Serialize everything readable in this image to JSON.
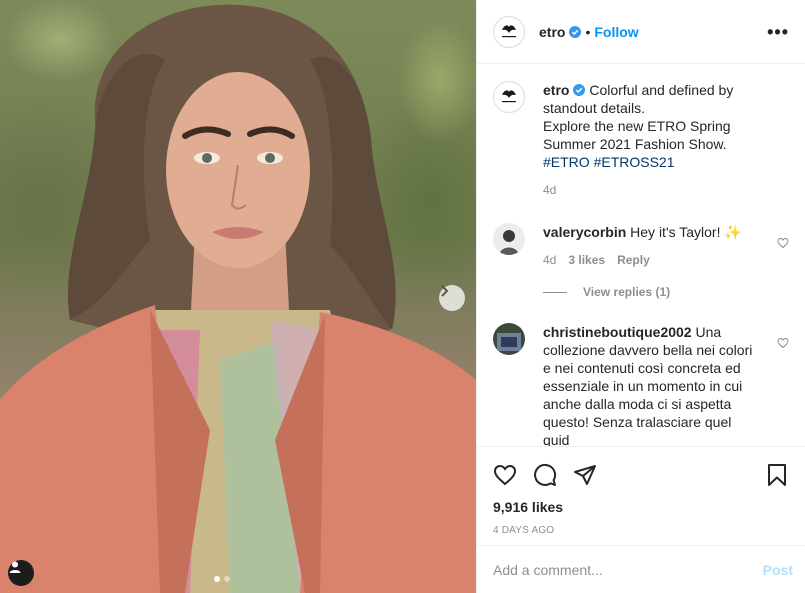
{
  "header": {
    "username": "etro",
    "separator": "•",
    "follow_label": "Follow",
    "more_label": "•••"
  },
  "caption": {
    "username": "etro",
    "line1": "Colorful and defined by standout details.",
    "line2": "Explore the new ETRO Spring Summer 2021 Fashion Show.",
    "hashtags": [
      "#ETRO",
      "#ETROSS21"
    ],
    "time": "4d"
  },
  "comments": [
    {
      "username": "valerycorbin",
      "text": "Hey it's Taylor! ✨",
      "time": "4d",
      "likes": "3 likes",
      "reply_label": "Reply",
      "view_replies": "View replies (1)"
    },
    {
      "username": "christineboutique2002",
      "text": "Una collezione davvero bella nei colori e nei contenuti così concreta ed essenziale in un momento in cui anche dalla moda ci si aspetta questo! Senza tralasciare quel quid"
    }
  ],
  "post": {
    "likes": "9,916 likes",
    "age": "4 DAYS AGO"
  },
  "add_comment": {
    "placeholder": "Add a comment...",
    "post_label": "Post"
  },
  "carousel": {
    "slides": 2,
    "active": 0
  },
  "colors": {
    "accent": "#0095f6",
    "verified": "#3897f0",
    "hashtag": "#00376b",
    "post_disabled": "#b2dffc",
    "muted": "#8e8e8e"
  },
  "icons": [
    "verified-badge-icon",
    "more-options-icon",
    "heart-icon",
    "comment-icon",
    "share-icon",
    "bookmark-icon",
    "chevron-right-icon",
    "user-tag-icon"
  ]
}
